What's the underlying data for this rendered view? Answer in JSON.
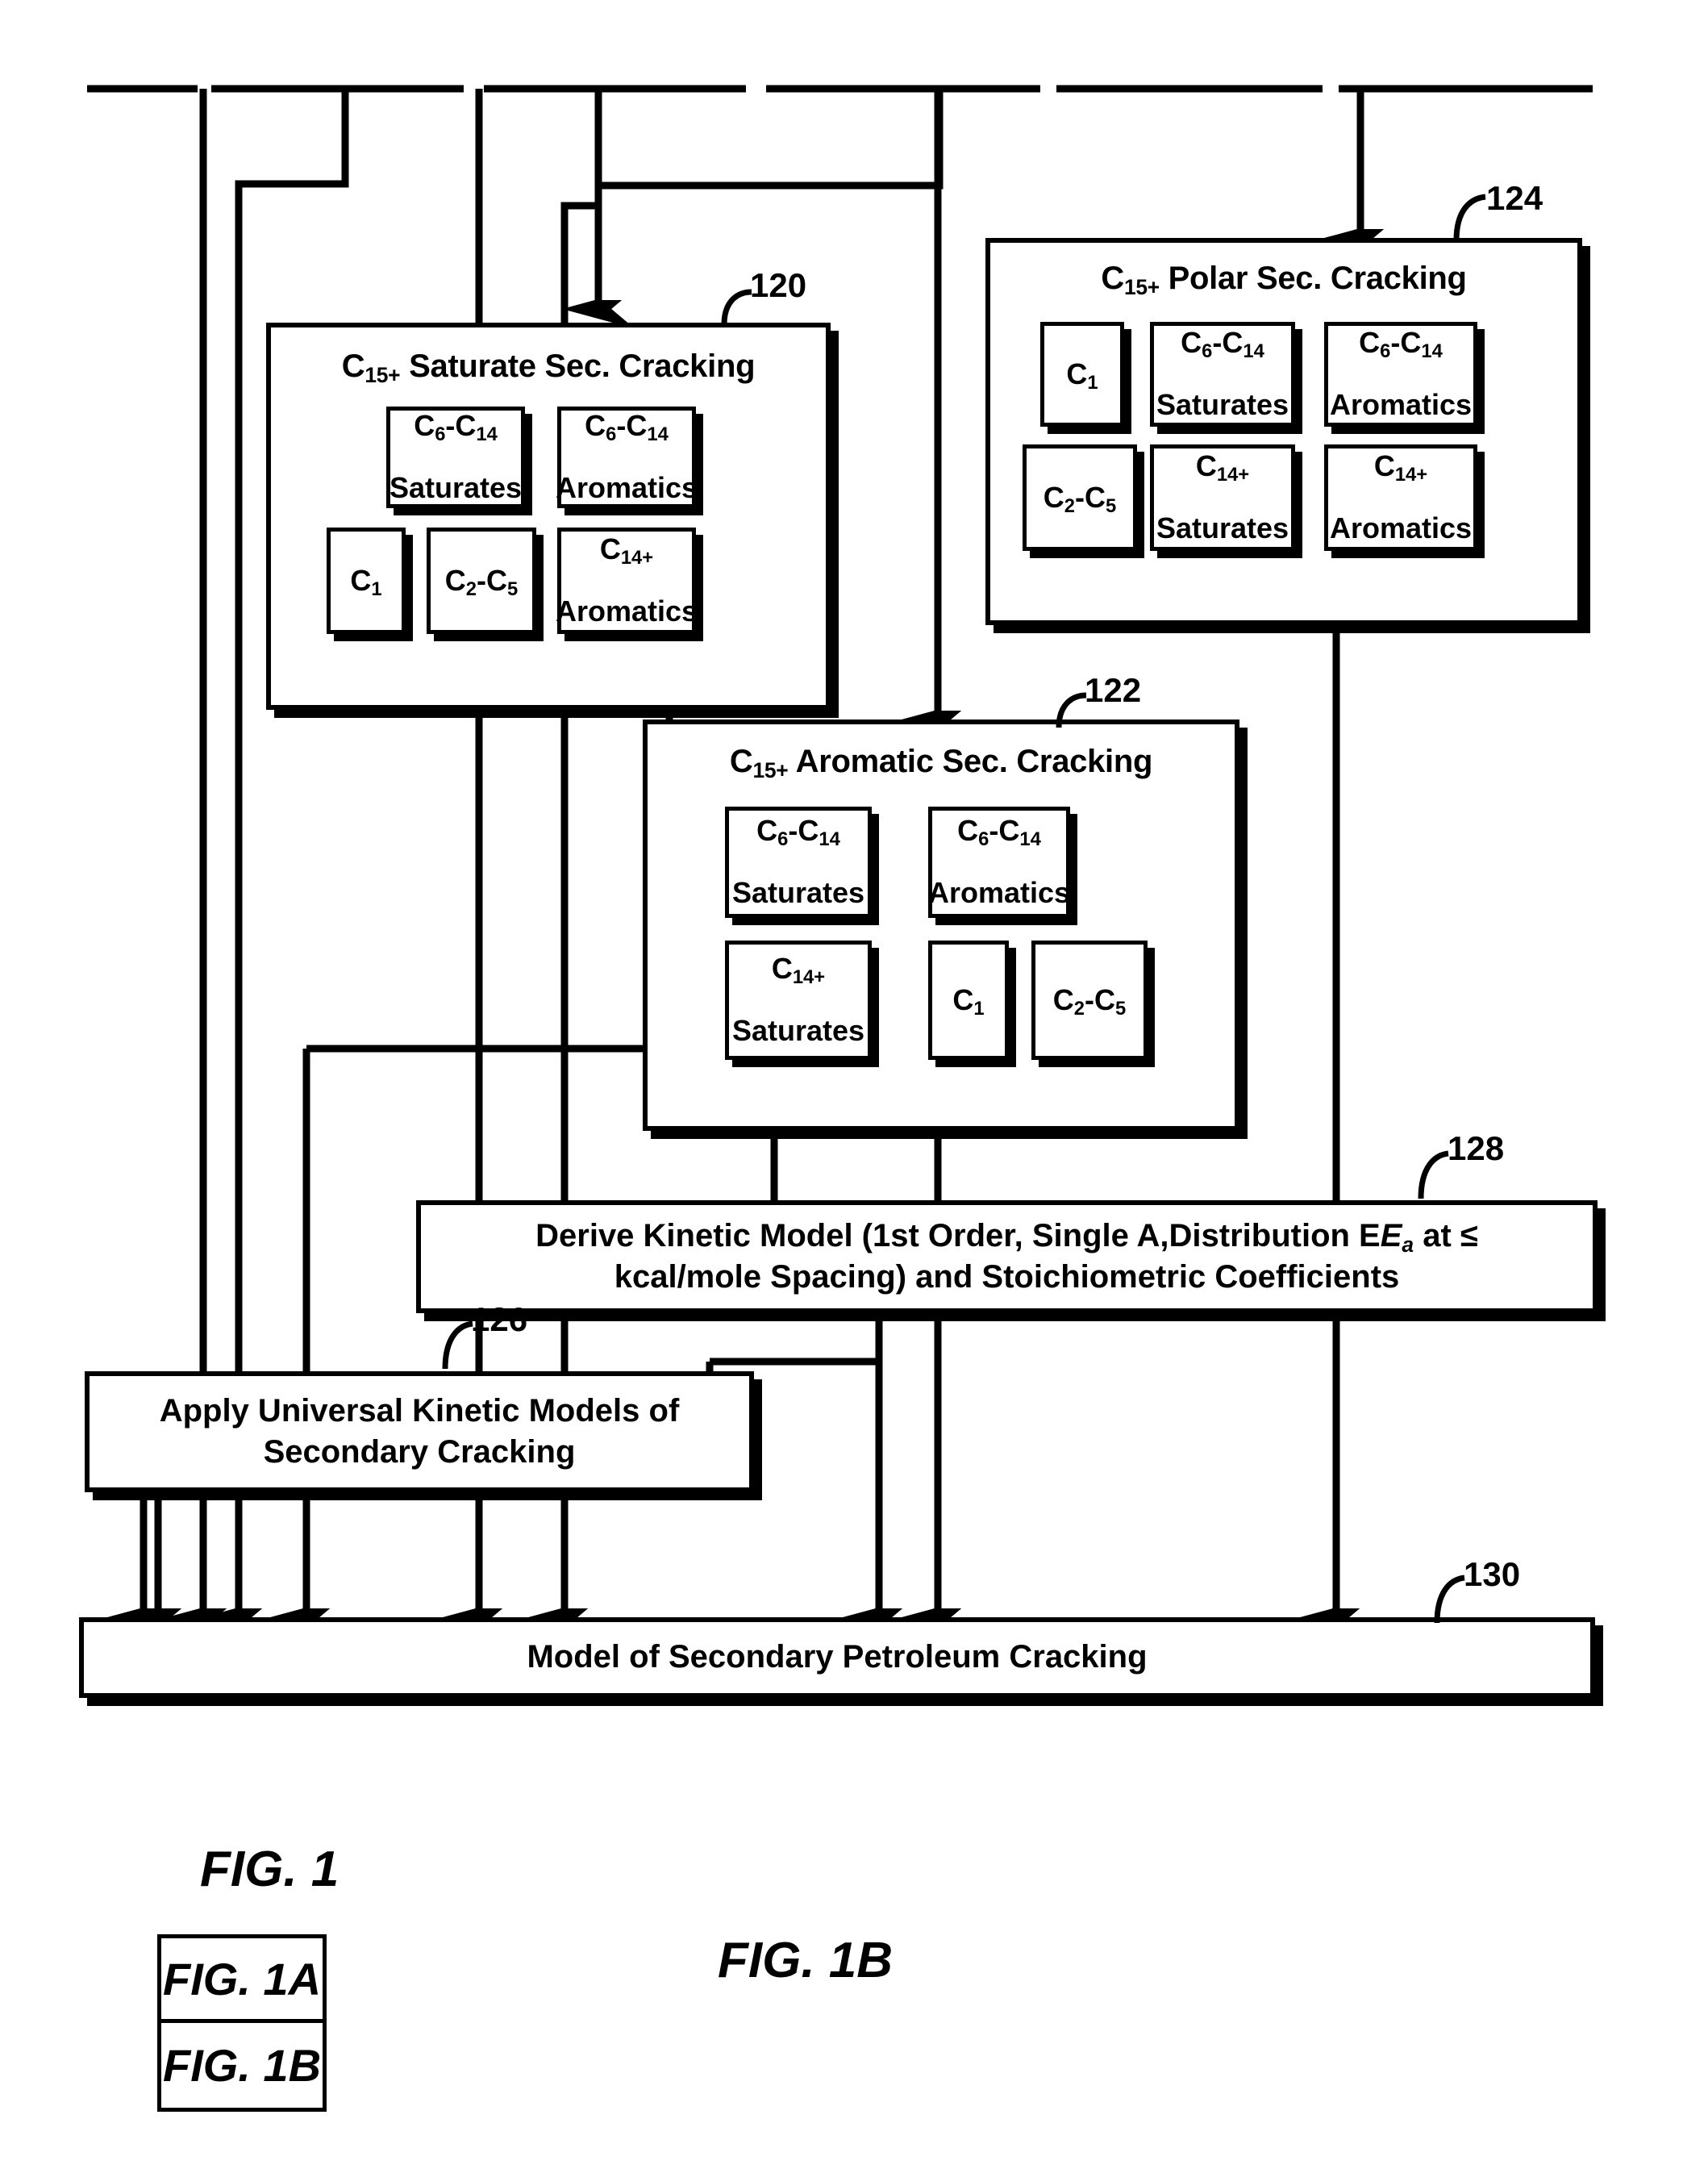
{
  "figure": {
    "number": "FIG. 1B",
    "sheet_caption": "FIG. 1",
    "key_rows": [
      "FIG. 1A",
      "FIG. 1B"
    ]
  },
  "groups": [
    {
      "ref": "120",
      "title_prefix": "C",
      "title_sub": "15+",
      "title": "C15+ Saturate Sec. Cracking",
      "title_rest": " Saturate Sec. Cracking",
      "cells": [
        {
          "line1": "C6-C14",
          "line2": "Saturates"
        },
        {
          "line1": "C6-C14",
          "line2": "Aromatics"
        },
        {
          "line1": "C1",
          "line2": ""
        },
        {
          "line1": "C2-C5",
          "line2": ""
        },
        {
          "line1": "C14+",
          "line2": "Aromatics"
        }
      ]
    },
    {
      "ref": "124",
      "title_rest": " Polar Sec. Cracking",
      "title": "C15+ Polar Sec. Cracking",
      "cells": [
        {
          "line1": "C1",
          "line2": ""
        },
        {
          "line1": "C6-C14",
          "line2": "Saturates"
        },
        {
          "line1": "C6-C14",
          "line2": "Aromatics"
        },
        {
          "line1": "C2-C5",
          "line2": ""
        },
        {
          "line1": "C14+",
          "line2": "Saturates"
        },
        {
          "line1": "C14+",
          "line2": "Aromatics"
        }
      ]
    },
    {
      "ref": "122",
      "title_rest": " Aromatic Sec. Cracking",
      "title": "C15+ Aromatic Sec. Cracking",
      "cells": [
        {
          "line1": "C6-C14",
          "line2": "Saturates"
        },
        {
          "line1": "C6-C14",
          "line2": "Aromatics"
        },
        {
          "line1": "C14+",
          "line2": "Saturates"
        },
        {
          "line1": "C1",
          "line2": ""
        },
        {
          "line1": "C2-C5",
          "line2": ""
        }
      ]
    }
  ],
  "process_boxes": {
    "derive_kinetic_model": {
      "ref": "128",
      "line1a": "Derive Kinetic Model (1st Order, Single A,Distribution E",
      "line1sub": "a",
      "line1b": " at ≤",
      "line2": "kcal/mole Spacing) and Stoichiometric Coefficients"
    },
    "apply_universal": {
      "ref": "126",
      "line1": "Apply Universal Kinetic Models of",
      "line2": "Secondary Cracking"
    },
    "model_output": {
      "ref": "130",
      "label": "Model of Secondary Petroleum Cracking"
    }
  },
  "colors": {
    "ink": "#000000",
    "paper": "#ffffff"
  }
}
